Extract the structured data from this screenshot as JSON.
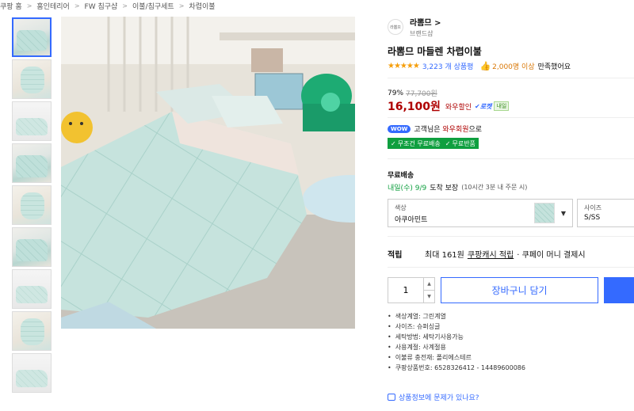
{
  "breadcrumb": [
    "쿠팡 홈",
    "홈인테리어",
    "FW 침구샵",
    "이불/침구세트",
    "차렵이불"
  ],
  "brand": {
    "logo_text": "라뽐므",
    "name": "라뽐므 >",
    "shop_label": "브랜드샵"
  },
  "product": {
    "title": "라뽐므 마들렌 차렵이불",
    "stars": "★★★★★",
    "review_count": "3,223 개 상품평",
    "satisfaction_count": "2,000명 이상",
    "satisfaction_suffix": "만족했어요"
  },
  "price": {
    "discount_rate": "79%",
    "original": "77,700원",
    "sale": "16,100원",
    "sale_label": "와우할인",
    "rocket_label": "로켓",
    "tomorrow_badge": "내일"
  },
  "wow": {
    "badge": "WOW",
    "prefix": "고객님은",
    "member": "와우회원",
    "suffix": "으로"
  },
  "benefits": [
    "무조건 무료배송",
    "무료반품"
  ],
  "shipping": {
    "label": "무료배송",
    "date": "내일(수) 9/9",
    "arrival": "도착 보장",
    "note": "(10시간 3분 내 주문 시)"
  },
  "options": {
    "color_label": "색상",
    "color_value": "아쿠아민트",
    "size_label": "사이즈",
    "size_value": "S/SS"
  },
  "cash": {
    "label": "적립",
    "text": "최대 161원",
    "link": "쿠팡캐시 적립",
    "sub": "· 쿠페이 머니 결제시"
  },
  "quantity": {
    "value": "1"
  },
  "cart_button": "장바구니 담기",
  "attributes": [
    "색상계열: 그린계열",
    "사이즈: 슈퍼싱글",
    "세탁방법: 세탁기사용가능",
    "사용계절: 사계절용",
    "이불류 충전재: 폴리에스테르",
    "쿠팡상품번호: 6528326412 - 14489600086"
  ],
  "report_link": "상품정보에 문제가 있나요?",
  "colors": {
    "accent": "#346aff",
    "price_red": "#ae0000",
    "benefit_green": "#0f9f3f",
    "star": "#f59e0b"
  },
  "icons": {
    "thumbs": "thumbs-up-icon",
    "check": "check-icon",
    "rocket": "rocket-icon",
    "report": "report-icon",
    "dropdown": "chevron-down-icon"
  }
}
